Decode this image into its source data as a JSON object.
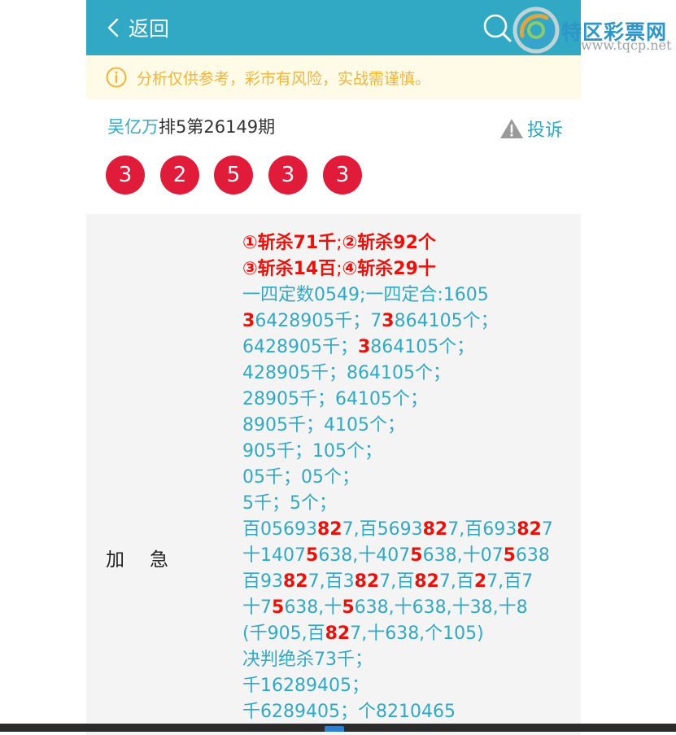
{
  "header": {
    "back_label": "返回"
  },
  "logo": {
    "title": "特区彩票网",
    "url": "www.tqcp.net"
  },
  "notice": {
    "text": "分析仅供参考，彩市有风险，实战需谨慎。"
  },
  "issue": {
    "author": "吴亿万",
    "title": "排5第26149期",
    "complain_label": "投诉"
  },
  "balls": [
    "3",
    "2",
    "5",
    "3",
    "3"
  ],
  "colors": {
    "header_bg": "#31a9c4",
    "ball": "#e11c3b",
    "highlight": "#e8120c",
    "notice_text": "#f2b33a"
  },
  "content": {
    "label_part1": "加",
    "label_part2": "急",
    "lines": [
      [
        "①斩杀71千",
        ";",
        "②斩杀92个"
      ],
      [
        "③斩杀14百",
        ";",
        "④斩杀29十"
      ],
      [
        "一四定数0549;一四定合:1605"
      ],
      [
        "3",
        "6428905千；7",
        "3",
        "864105个；"
      ],
      [
        "6428905千；",
        "3",
        "864105个；"
      ],
      [
        "428905千；864105个；"
      ],
      [
        "28905千；64105个；"
      ],
      [
        "8905千；4105个；"
      ],
      [
        "905千；105个；"
      ],
      [
        "05千；05个；"
      ],
      [
        "5千；5个；"
      ],
      [
        "百05693",
        "82",
        "7,百5693",
        "82",
        "7,百693",
        "82",
        "7"
      ],
      [
        "十1407",
        "5",
        "638,十407",
        "5",
        "638,十07",
        "5",
        "638"
      ],
      [
        "百93",
        "82",
        "7,百3",
        "82",
        "7,百",
        "82",
        "7,百",
        "2",
        "7,百7"
      ],
      [
        "十7",
        "5",
        "638,十",
        "5",
        "638,十638,十38,十8"
      ],
      [
        "(千905,百",
        "82",
        "7,十638,个105)"
      ],
      [
        "决判绝杀73千；"
      ],
      [
        "千16289405；"
      ],
      [
        "千6289405；个8210465"
      ]
    ]
  }
}
